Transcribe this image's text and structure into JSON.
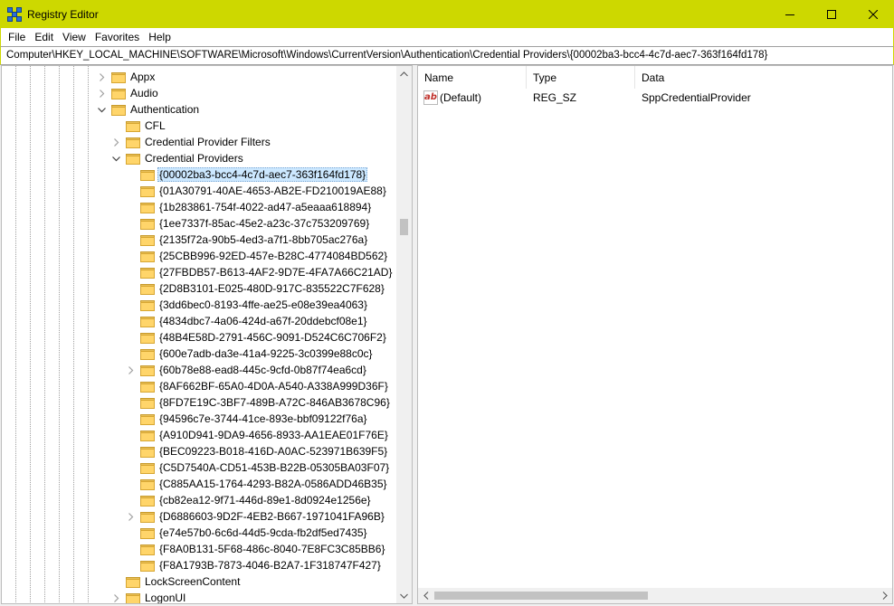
{
  "window": {
    "title": "Registry Editor",
    "title_bar_color": "#cdd800"
  },
  "menu": {
    "items": [
      "File",
      "Edit",
      "View",
      "Favorites",
      "Help"
    ]
  },
  "address": {
    "path": "Computer\\HKEY_LOCAL_MACHINE\\SOFTWARE\\Microsoft\\Windows\\CurrentVersion\\Authentication\\Credential Providers\\{00002ba3-bcc4-4c7d-aec7-363f164fd178}"
  },
  "tree": {
    "rows": [
      {
        "label": "Appx",
        "level": 0,
        "expander": "collapsed"
      },
      {
        "label": "Audio",
        "level": 0,
        "expander": "collapsed"
      },
      {
        "label": "Authentication",
        "level": 0,
        "expander": "expanded"
      },
      {
        "label": "CFL",
        "level": 1,
        "expander": "none"
      },
      {
        "label": "Credential Provider Filters",
        "level": 1,
        "expander": "collapsed"
      },
      {
        "label": "Credential Providers",
        "level": 1,
        "expander": "expanded"
      },
      {
        "label": "{00002ba3-bcc4-4c7d-aec7-363f164fd178}",
        "level": 2,
        "expander": "none",
        "selected": true
      },
      {
        "label": "{01A30791-40AE-4653-AB2E-FD210019AE88}",
        "level": 2,
        "expander": "none"
      },
      {
        "label": "{1b283861-754f-4022-ad47-a5eaaa618894}",
        "level": 2,
        "expander": "none"
      },
      {
        "label": "{1ee7337f-85ac-45e2-a23c-37c753209769}",
        "level": 2,
        "expander": "none"
      },
      {
        "label": "{2135f72a-90b5-4ed3-a7f1-8bb705ac276a}",
        "level": 2,
        "expander": "none"
      },
      {
        "label": "{25CBB996-92ED-457e-B28C-4774084BD562}",
        "level": 2,
        "expander": "none"
      },
      {
        "label": "{27FBDB57-B613-4AF2-9D7E-4FA7A66C21AD}",
        "level": 2,
        "expander": "none"
      },
      {
        "label": "{2D8B3101-E025-480D-917C-835522C7F628}",
        "level": 2,
        "expander": "none"
      },
      {
        "label": "{3dd6bec0-8193-4ffe-ae25-e08e39ea4063}",
        "level": 2,
        "expander": "none"
      },
      {
        "label": "{4834dbc7-4a06-424d-a67f-20ddebcf08e1}",
        "level": 2,
        "expander": "none"
      },
      {
        "label": "{48B4E58D-2791-456C-9091-D524C6C706F2}",
        "level": 2,
        "expander": "none"
      },
      {
        "label": "{600e7adb-da3e-41a4-9225-3c0399e88c0c}",
        "level": 2,
        "expander": "none"
      },
      {
        "label": "{60b78e88-ead8-445c-9cfd-0b87f74ea6cd}",
        "level": 2,
        "expander": "collapsed"
      },
      {
        "label": "{8AF662BF-65A0-4D0A-A540-A338A999D36F}",
        "level": 2,
        "expander": "none"
      },
      {
        "label": "{8FD7E19C-3BF7-489B-A72C-846AB3678C96}",
        "level": 2,
        "expander": "none"
      },
      {
        "label": "{94596c7e-3744-41ce-893e-bbf09122f76a}",
        "level": 2,
        "expander": "none"
      },
      {
        "label": "{A910D941-9DA9-4656-8933-AA1EAE01F76E}",
        "level": 2,
        "expander": "none"
      },
      {
        "label": "{BEC09223-B018-416D-A0AC-523971B639F5}",
        "level": 2,
        "expander": "none"
      },
      {
        "label": "{C5D7540A-CD51-453B-B22B-05305BA03F07}",
        "level": 2,
        "expander": "none"
      },
      {
        "label": "{C885AA15-1764-4293-B82A-0586ADD46B35}",
        "level": 2,
        "expander": "none"
      },
      {
        "label": "{cb82ea12-9f71-446d-89e1-8d0924e1256e}",
        "level": 2,
        "expander": "none"
      },
      {
        "label": "{D6886603-9D2F-4EB2-B667-1971041FA96B}",
        "level": 2,
        "expander": "collapsed"
      },
      {
        "label": "{e74e57b0-6c6d-44d5-9cda-fb2df5ed7435}",
        "level": 2,
        "expander": "none"
      },
      {
        "label": "{F8A0B131-5F68-486c-8040-7E8FC3C85BB6}",
        "level": 2,
        "expander": "none"
      },
      {
        "label": "{F8A1793B-7873-4046-B2A7-1F318747F427}",
        "level": 2,
        "expander": "none"
      },
      {
        "label": "LockScreenContent",
        "level": 1,
        "expander": "none"
      },
      {
        "label": "LogonUI",
        "level": 1,
        "expander": "collapsed"
      }
    ]
  },
  "values": {
    "columns": {
      "name": "Name",
      "type": "Type",
      "data": "Data"
    },
    "rows": [
      {
        "name": "(Default)",
        "type": "REG_SZ",
        "data": "SppCredentialProvider",
        "icon": "string-value-icon",
        "icon_text": "ab"
      }
    ]
  }
}
